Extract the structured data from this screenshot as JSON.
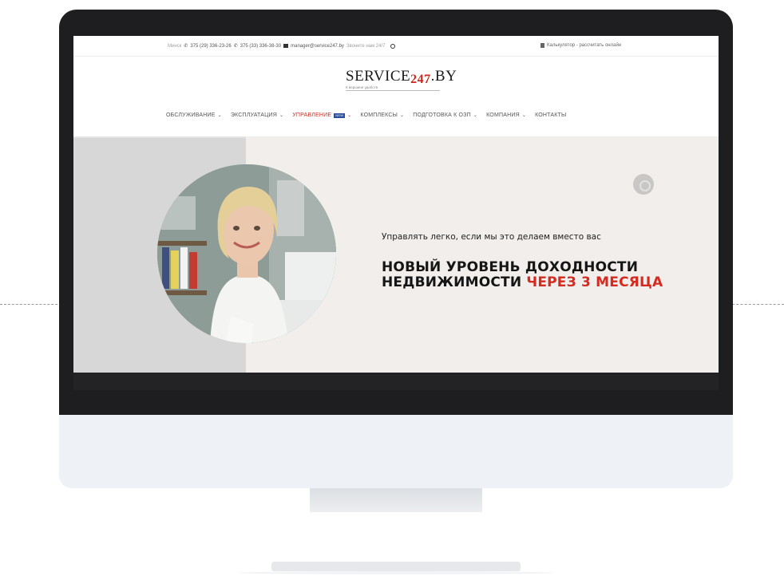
{
  "topbar": {
    "city": "Минск",
    "phone_1": "375 (29) 336-23-26",
    "phone_2": "375 (33) 336-38-30",
    "email": "manager@service247.by",
    "hours": "Звоните нам 24/7",
    "docs_label": "Калькулятор - рассчитать онлайн"
  },
  "logo": {
    "name_main": "SERVICE",
    "name_accent": "247",
    "name_tail": ".BY",
    "tagline": "К вершине удобств"
  },
  "nav": {
    "items": [
      {
        "label": "ОБСЛУЖИВАНИЕ",
        "has_chevron": true
      },
      {
        "label": "ЭКСПЛУАТАЦИЯ",
        "has_chevron": true
      },
      {
        "label": "УПРАВЛЕНИЕ",
        "has_chevron": true,
        "active": true,
        "badge": "NEW"
      },
      {
        "label": "КОМПЛЕКСЫ",
        "has_chevron": true
      },
      {
        "label": "ПОДГОТОВКА К ОЗП",
        "has_chevron": true
      },
      {
        "label": "КОМПАНИЯ",
        "has_chevron": true
      },
      {
        "label": "КОНТАКТЫ",
        "has_chevron": false
      }
    ]
  },
  "hero": {
    "subtitle": "Управлять легко, если мы это делаем вместо вас",
    "title_line1": "НОВЫЙ УРОВЕНЬ ДОХОДНОСТИ",
    "title_line2_plain": "НЕДВИЖИМОСТИ ",
    "title_line2_highlight": "ЧЕРЕЗ 3 МЕСЯЦА"
  },
  "colors": {
    "accent_red": "#d42a1f",
    "bezel": "#1e1e21",
    "hero_bg": "#f1eeeb",
    "hero_side": "#d7d7d7"
  },
  "icons": [
    "phone-icon",
    "mail-icon",
    "search-icon",
    "document-icon",
    "chevron-down-icon",
    "slider-dot-icon"
  ]
}
